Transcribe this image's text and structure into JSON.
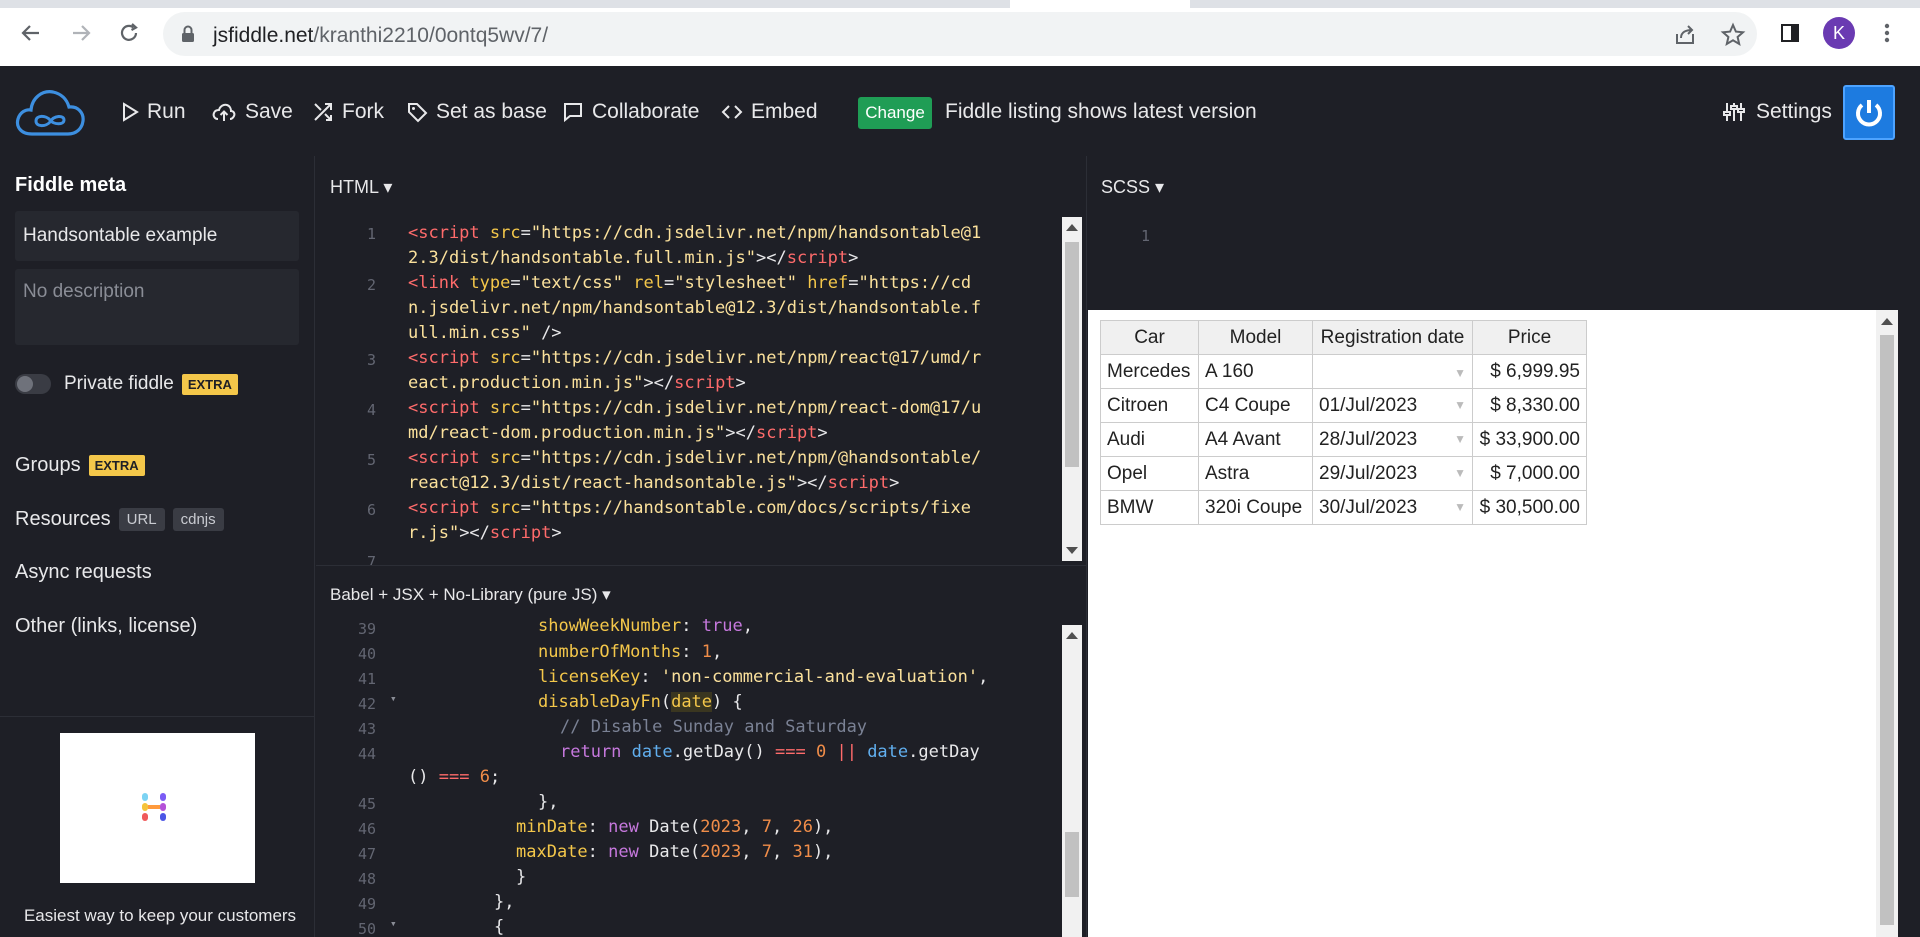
{
  "browser": {
    "url_domain": "jsfiddle.net",
    "url_path": "/kranthi2210/0ontq5wv/7/",
    "avatar_letter": "K"
  },
  "toolbar": {
    "run": "Run",
    "save": "Save",
    "fork": "Fork",
    "set_as_base": "Set as base",
    "collaborate": "Collaborate",
    "embed": "Embed",
    "change": "Change",
    "status": "Fiddle listing shows latest version",
    "settings": "Settings"
  },
  "sidebar": {
    "meta_title": "Fiddle meta",
    "fiddle_name": "Handsontable example",
    "description_placeholder": "No description",
    "private_label": "Private fiddle",
    "extra": "EXTRA",
    "groups": "Groups",
    "resources": "Resources",
    "resources_tags": [
      "URL",
      "cdnjs"
    ],
    "async": "Async requests",
    "other": "Other (links, license)",
    "ad_text": "Easiest way to keep your customers"
  },
  "panels": {
    "html_header": "HTML",
    "scss_header": "SCSS",
    "js_header": "Babel + JSX + No-Library (pure JS)"
  },
  "html_lines": [
    "1",
    "2",
    "3",
    "4",
    "5",
    "6",
    "7"
  ],
  "scss_lines": [
    "1"
  ],
  "js_lines": [
    "39",
    "40",
    "41",
    "42",
    "43",
    "44",
    "45",
    "46",
    "47",
    "48",
    "49",
    "50"
  ],
  "table": {
    "headers": [
      "Car",
      "Model",
      "Registration date",
      "Price"
    ],
    "rows": [
      [
        "Mercedes",
        "A 160",
        "",
        "$ 6,999.95"
      ],
      [
        "Citroen",
        "C4 Coupe",
        "01/Jul/2023",
        "$ 8,330.00"
      ],
      [
        "Audi",
        "A4 Avant",
        "28/Jul/2023",
        "$ 33,900.00"
      ],
      [
        "Opel",
        "Astra",
        "29/Jul/2023",
        "$ 7,000.00"
      ],
      [
        "BMW",
        "320i Coupe",
        "30/Jul/2023",
        "$ 30,500.00"
      ]
    ]
  }
}
